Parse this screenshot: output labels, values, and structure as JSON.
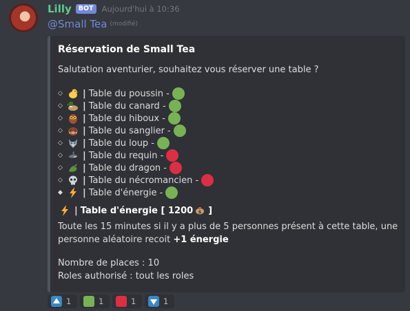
{
  "author": {
    "name": "Lilly",
    "badge": "BOT",
    "timestamp": "Aujourd'hui à 10:36"
  },
  "message": {
    "mention": "@Small Tea",
    "edited": "(modifié)"
  },
  "embed": {
    "title": "Réservation de Small Tea",
    "description": "Salutation aventurier, souhaitez vous réserver une table ?",
    "tables": [
      {
        "label": "Table du poussin -",
        "emoji": "chick-emoji",
        "status": "green",
        "status_color": "#77b255"
      },
      {
        "label": "Table du canard -",
        "emoji": "duck-emoji",
        "status": "green",
        "status_color": "#77b255"
      },
      {
        "label": "Table du hiboux -",
        "emoji": "owl-emoji",
        "status": "green",
        "status_color": "#77b255"
      },
      {
        "label": "Table du sanglier -",
        "emoji": "boar-emoji",
        "status": "green",
        "status_color": "#77b255"
      },
      {
        "label": "Table du loup -",
        "emoji": "wolf-emoji",
        "status": "green",
        "status_color": "#77b255"
      },
      {
        "label": "Table du requin -",
        "emoji": "shark-emoji",
        "status": "red",
        "status_color": "#dd2e44"
      },
      {
        "label": "Table du dragon -",
        "emoji": "dragon-emoji",
        "status": "red",
        "status_color": "#dd2e44"
      },
      {
        "label": "Table du nécromancien -",
        "emoji": "skull-emoji",
        "status": "red",
        "status_color": "#dd2e44"
      },
      {
        "label": "Table d'énergie -",
        "emoji": "lightning-emoji",
        "status": "green",
        "status_color": "#77b255"
      }
    ],
    "energy_section": {
      "heading_text": "Table d'énergie [ 1200",
      "heading_close": "]",
      "body_before": "Toute les 15 minutes si il y a plus de 5 personnes présent à cette table, une personne aléatoire recoit ",
      "body_bold": "+1 énergie"
    },
    "places": "Nombre de places : 10",
    "roles": "Roles authorisé : tout les roles"
  },
  "reactions": [
    {
      "icon": "up-arrow-icon",
      "count": "1",
      "color": "#3b88c3"
    },
    {
      "icon": "green-square-icon",
      "count": "1",
      "color": "#77b255"
    },
    {
      "icon": "red-square-icon",
      "count": "1",
      "color": "#dd2e44"
    },
    {
      "icon": "down-arrow-icon",
      "count": "1",
      "color": "#3b88c3"
    }
  ]
}
